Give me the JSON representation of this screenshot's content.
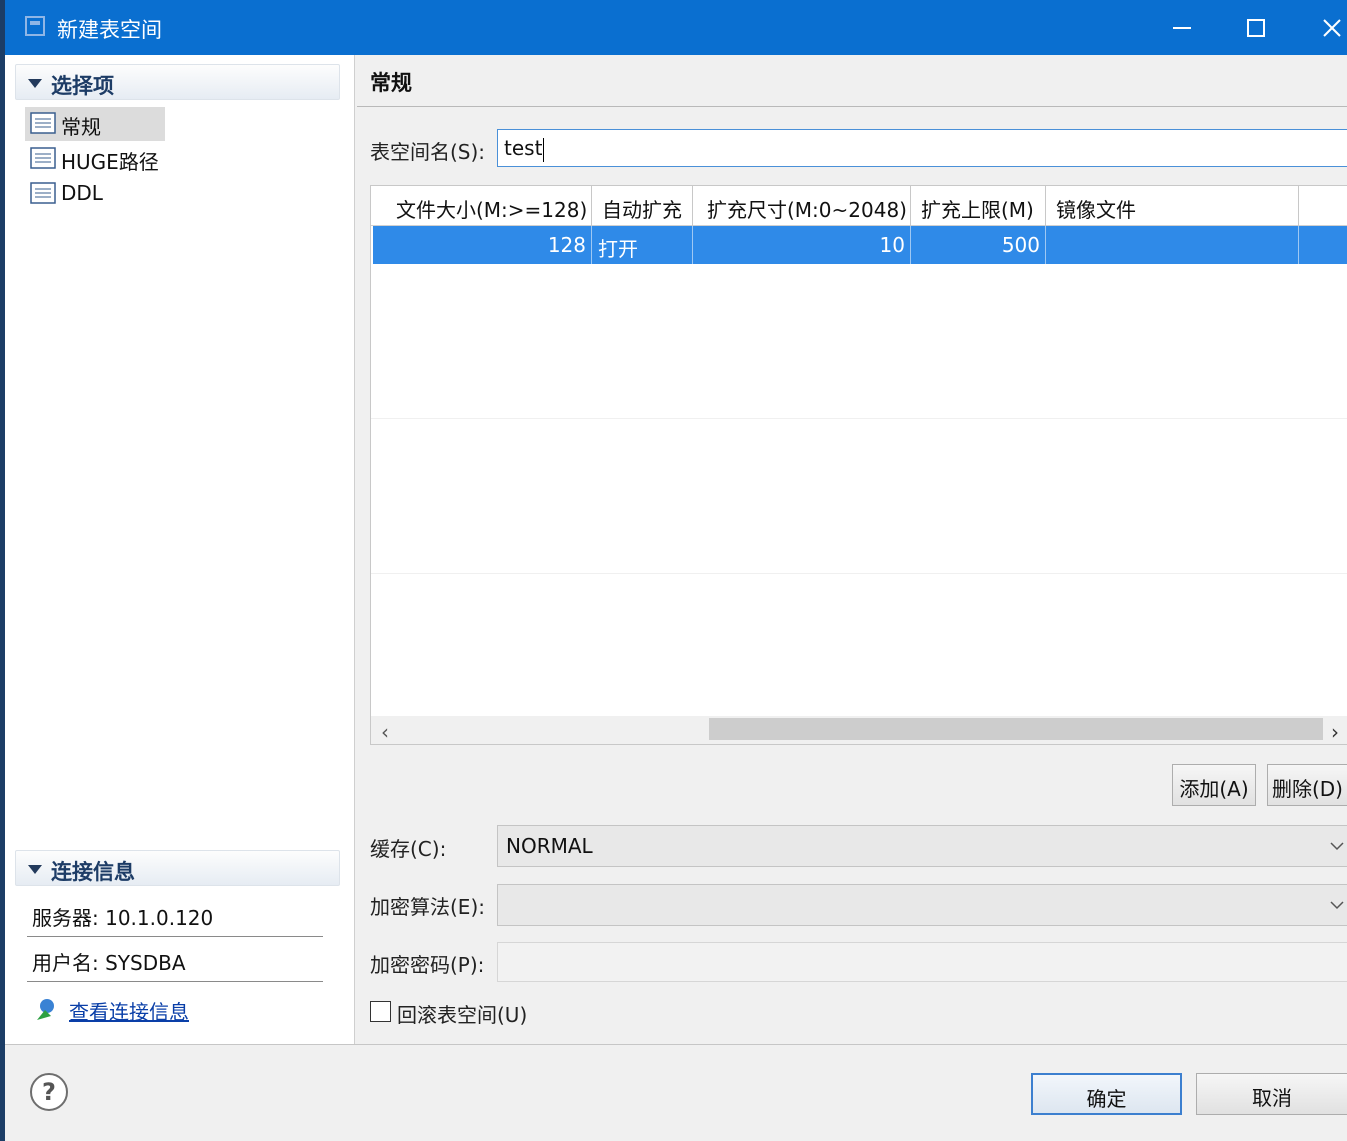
{
  "window": {
    "title": "新建表空间",
    "controls": [
      "minimize",
      "maximize",
      "close"
    ]
  },
  "sidebar": {
    "options_header": "选择项",
    "items": [
      {
        "label": "常规",
        "selected": true,
        "icon": "list-icon"
      },
      {
        "label": "HUGE路径",
        "selected": false,
        "icon": "list-icon"
      },
      {
        "label": "DDL",
        "selected": false,
        "icon": "list-icon"
      }
    ],
    "connection_header": "连接信息",
    "server": "服务器: 10.1.0.120",
    "user": "用户名: SYSDBA",
    "view_link": "查看连接信息"
  },
  "main": {
    "title": "常规",
    "name_label": "表空间名(S):",
    "name_value": "test",
    "table": {
      "columns": [
        "文件大小(M:>=128)",
        "自动扩充",
        "扩充尺寸(M:0~2048)",
        "扩充上限(M)",
        "镜像文件"
      ],
      "rows": [
        [
          "128",
          "打开",
          "10",
          "500",
          ""
        ]
      ]
    },
    "add_button": "添加(A)",
    "delete_button": "删除(D)",
    "cache_label": "缓存(C):",
    "cache_value": "NORMAL",
    "encrypt_algo_label": "加密算法(E):",
    "encrypt_algo_value": "",
    "encrypt_pwd_label": "加密密码(P):",
    "rollback_label": "回滚表空间(U)",
    "rollback_checked": false
  },
  "footer": {
    "ok_button": "确定",
    "cancel_button": "取消",
    "help_icon": "help-icon"
  },
  "colors": {
    "titlebar": "#0a6fd0",
    "selection": "#2f8ae8",
    "link": "#0a3fa8"
  }
}
